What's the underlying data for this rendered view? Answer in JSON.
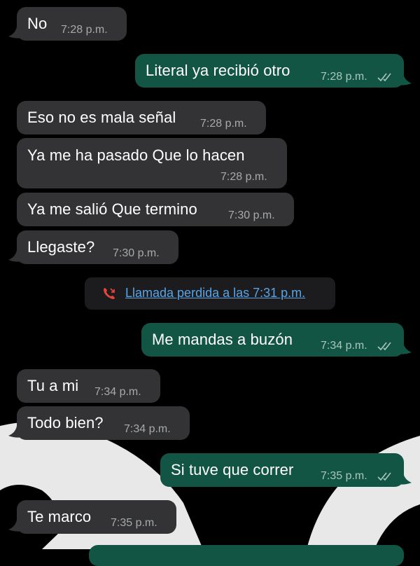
{
  "chat": {
    "messages": [
      {
        "dir": "in",
        "text": "No",
        "time": "7:28 p.m."
      },
      {
        "dir": "out",
        "text": "Literal ya recibió otro",
        "time": "7:28 p.m.",
        "status": "read-double-check-icon"
      },
      {
        "dir": "in",
        "text": "Eso no es mala señal",
        "time": "7:28 p.m."
      },
      {
        "dir": "in",
        "text": "Ya me ha pasado Que lo hacen",
        "time": "7:28 p.m."
      },
      {
        "dir": "in",
        "text": "Ya me salió Que termino",
        "time": "7:30 p.m."
      },
      {
        "dir": "in",
        "text": "Llegaste?",
        "time": "7:30 p.m."
      },
      {
        "dir": "out",
        "text": "Me mandas a buzón",
        "time": "7:34 p.m.",
        "status": "read-double-check-icon"
      },
      {
        "dir": "in",
        "text": "Tu a mi",
        "time": "7:34 p.m."
      },
      {
        "dir": "in",
        "text": "Todo bien?",
        "time": "7:34 p.m."
      },
      {
        "dir": "out",
        "text": "Si tuve que correr",
        "time": "7:35 p.m.",
        "status": "read-double-check-icon"
      },
      {
        "dir": "in",
        "text": "Te marco",
        "time": "7:35 p.m."
      }
    ],
    "missed_call": {
      "text": "Llamada perdida a las 7:31 p.m.",
      "icon": "missed-call-icon"
    }
  },
  "colors": {
    "incoming_bubble": "#333335",
    "outgoing_bubble": "#135544",
    "background": "#000000",
    "wallpaper_shape": "#e8e8e8",
    "missed_call_icon": "#e5443a",
    "link": "#5aa5e6"
  }
}
